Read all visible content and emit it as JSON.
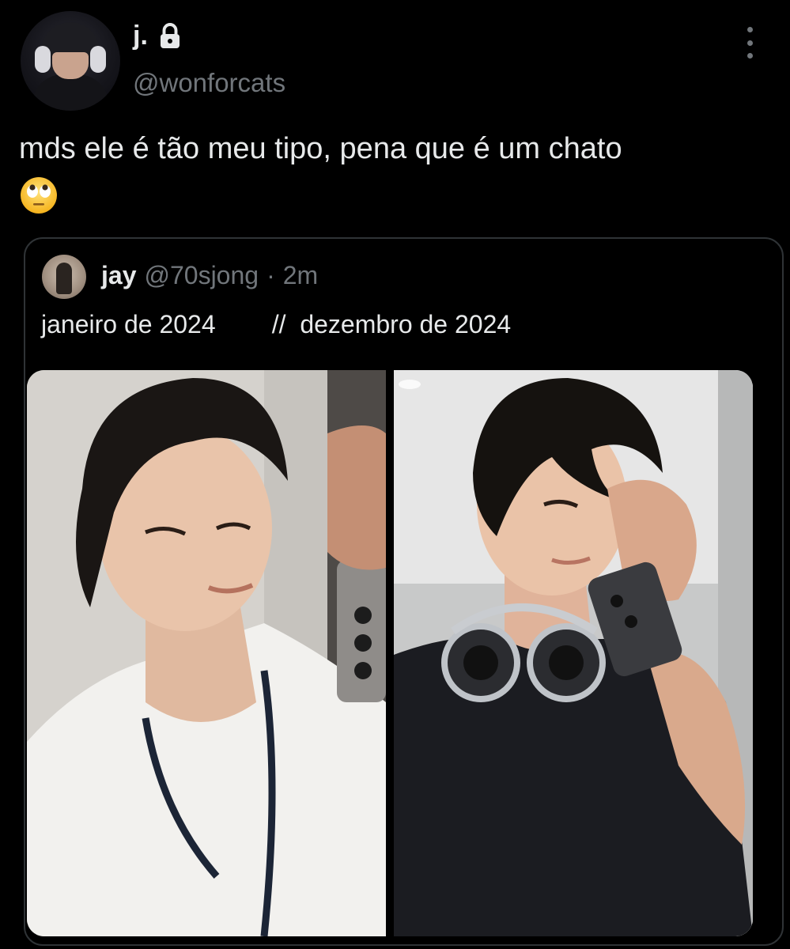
{
  "tweet": {
    "display_name": "j.",
    "handle": "@wonforcats",
    "text": "mds ele é tão meu tipo, pena que é um chato",
    "emoji": "face-with-rolling-eyes"
  },
  "quoted": {
    "display_name": "jay",
    "handle": "@70sjong",
    "separator": "·",
    "time": "2m",
    "text": "janeiro de 2024        //  dezembro de 2024",
    "media": [
      {
        "name": "photo-left",
        "description_icon": "mirror-selfie"
      },
      {
        "name": "photo-right",
        "description_icon": "mirror-selfie"
      }
    ]
  },
  "colors": {
    "background": "#000000",
    "primary_text": "#e7e9ea",
    "secondary_text": "#71767b",
    "border": "#2f3336"
  }
}
